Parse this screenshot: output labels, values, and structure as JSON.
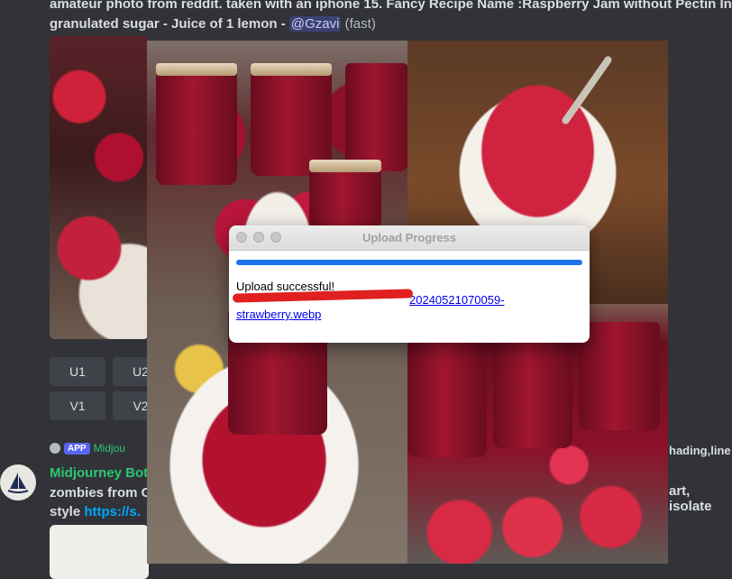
{
  "message": {
    "header_text": "amateur photo from reddit. taken with an iphone 15. Fancy Recipe Name :Raspberry Jam without Pectin Ing",
    "header_text2": "granulated sugar - Juice of 1 lemon - ",
    "mention": "@Gzavi",
    "speed": "(fast)"
  },
  "buttons": [
    {
      "label": "U1"
    },
    {
      "label": "U2"
    },
    {
      "label": "V1"
    },
    {
      "label": "V2"
    }
  ],
  "next_message": {
    "app_badge": "APP",
    "app_name": "Midjou",
    "bot_name": "Midjourney Bot",
    "line2": "zombies from C",
    "line3_prefix": "style ",
    "line3_link": "https://s.",
    "right_fragment1": "hading,line",
    "right_fragment2": "art, isolate"
  },
  "dialog": {
    "title": "Upload Progress",
    "progress": 1.0,
    "status": "Upload successful!",
    "url_visible": "20240521070059-",
    "url_line2": "strawberry.webp",
    "redaction_color": "#e02020"
  },
  "colors": {
    "background": "#313338",
    "progress": "#1a73e8",
    "link": "#0000ee",
    "bot_green": "#2dc770"
  }
}
